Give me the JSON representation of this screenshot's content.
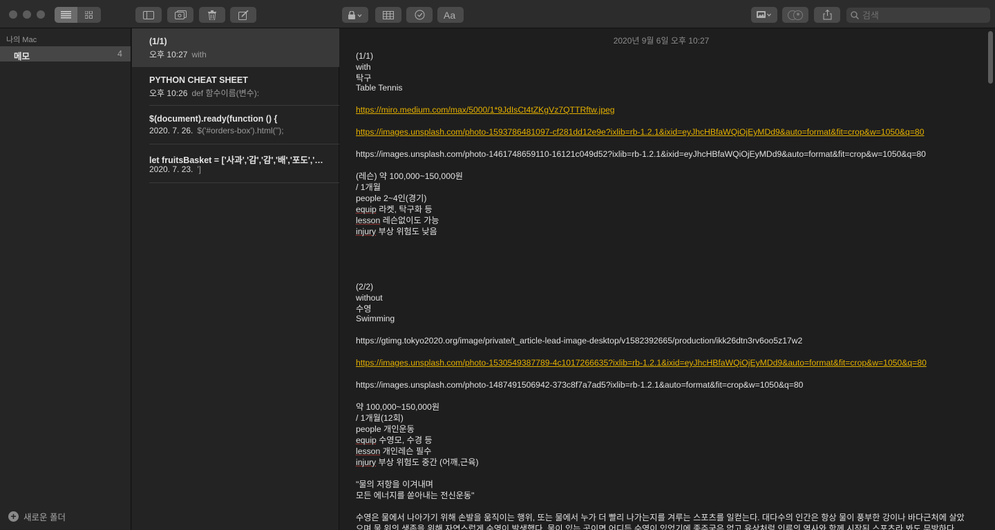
{
  "toolbar": {
    "search_placeholder": "검색",
    "list_view": "list-icon",
    "gallery_view": "grid-icon"
  },
  "sidebar": {
    "section": "나의 Mac",
    "folder_label": "메모",
    "folder_count": "4",
    "new_folder": "새로운 폴더"
  },
  "notes": [
    {
      "title": "(1/1)",
      "date": "오후 10:27",
      "preview": "with"
    },
    {
      "title": "PYTHON CHEAT SHEET",
      "date": "오후 10:26",
      "preview": "def 함수이름(변수):"
    },
    {
      "title": "$(document).ready(function () {",
      "date": "2020. 7. 26.",
      "preview": "$('#orders-box').html('');"
    },
    {
      "title": "let fruitsBasket = ['사과','감','감','배','포도','포도','딸기','포도','감','수박','딸기']",
      "date": "2020. 7. 23.",
      "preview": "']"
    }
  ],
  "editor": {
    "date": "2020년 9월 6일 오후 10:27",
    "l01": "(1/1)",
    "l02": "with",
    "l03": "탁구",
    "l04": "Table Tennis",
    "l05": "https://miro.medium.com/max/5000/1*9JdIsCt4tZKgVz7QTTRftw.jpeg",
    "l06": "https://images.unsplash.com/photo-1593786481097-cf281dd12e9e?ixlib=rb-1.2.1&ixid=eyJhcHBfaWQiOjEyMDd9&auto=format&fit=crop&w=1050&q=80",
    "l07": "https://images.unsplash.com/photo-1461748659110-16121c049d52?ixlib=rb-1.2.1&ixid=eyJhcHBfaWQiOjEyMDd9&auto=format&fit=crop&w=1050&q=80",
    "l08": "(레슨) 약 100,000~150,000원",
    "l09": "/ 1개월",
    "l10": "people 2~4인(경기)",
    "l11a": "equip",
    "l11b": " 라켓, 탁구화 등",
    "l12a": "lesson",
    "l12b": " 레슨없이도 가능",
    "l13a": "injury",
    "l13b": " 부상 위험도 낮음",
    "l14": "(2/2)",
    "l15": "without",
    "l16": "수영",
    "l17": "Swimming",
    "l18": "https://gtimg.tokyo2020.org/image/private/t_article-lead-image-desktop/v1582392665/production/ikk26dtn3rv6oo5z17w2",
    "l19": "https://images.unsplash.com/photo-1530549387789-4c1017266635?ixlib=rb-1.2.1&ixid=eyJhcHBfaWQiOjEyMDd9&auto=format&fit=crop&w=1050&q=80",
    "l20": "https://images.unsplash.com/photo-1487491506942-373c8f7a7ad5?ixlib=rb-1.2.1&auto=format&fit=crop&w=1050&q=80",
    "l21": "약 100,000~150,000원",
    "l22": "/ 1개월(12회)",
    "l23": "people 개인운동",
    "l24a": "equip",
    "l24b": " 수영모, 수경 등",
    "l25a": "lesson",
    "l25b": " 개인레슨 필수",
    "l26a": "injury",
    "l26b": " 부상 위험도 중간 (어깨,근육)",
    "l27": "\"물의 저항을 이겨내며",
    "l28": "모든 에너지를 쏟아내는 전신운동\"",
    "l29": "수영은 물에서 나아가기 위해 손발을 움직이는 행위, 또는 물에서 누가 더 빨리 나가는지를 겨루는 스포츠를 일컫는다. 대다수의 인간은 항상 물이 풍부한 강이나 바다근처에 살았으며 물 위의 생존을 위해 자연스럽게 수영이 발생했다. 물이 있는 곳이면 어디든 수영이 있었기에 종주국은 없고 육상처럼 인류의 역사와 함께 시작된 스포츠라 봐도 무방하다."
  }
}
